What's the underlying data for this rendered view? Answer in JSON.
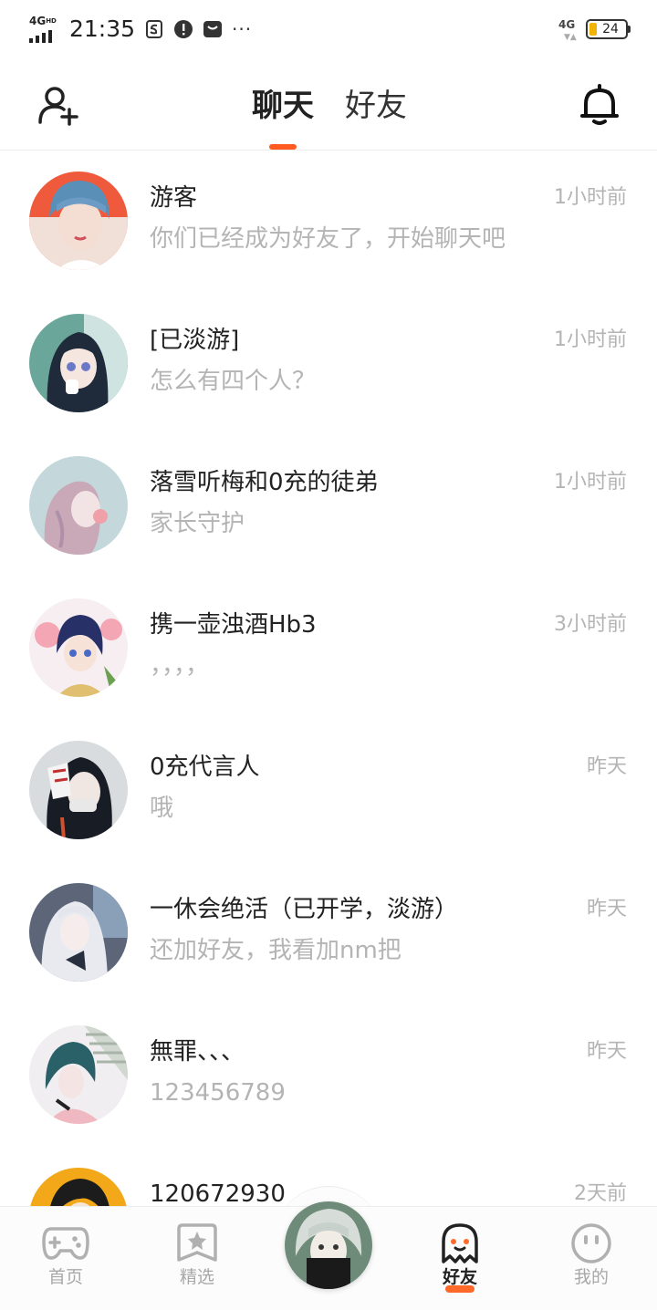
{
  "status_bar": {
    "network": "4G",
    "network_sup": "HD",
    "time": "21:35",
    "right_network": "4G",
    "battery": "24",
    "battery_level": 0.24,
    "more": "···"
  },
  "header": {
    "tabs": [
      {
        "label": "聊天",
        "active": true
      },
      {
        "label": "好友",
        "active": false
      }
    ],
    "accent_color": "#ff5a1f",
    "left_icon": "add-user-icon",
    "right_icon": "bell-icon"
  },
  "chats": [
    {
      "name": "游客",
      "message": "你们已经成为好友了，开始聊天吧",
      "time": "1小时前"
    },
    {
      "name": "[已淡游]",
      "message": "怎么有四个人？",
      "time": "1小时前"
    },
    {
      "name": "落雪听梅和0充的徒弟",
      "message": "家长守护",
      "time": "1小时前"
    },
    {
      "name": "携一壶浊酒Hb3",
      "message": "，，，，",
      "time": "3小时前"
    },
    {
      "name": "0充代言人",
      "message": "哦",
      "time": "昨天"
    },
    {
      "name": "一休会绝活（已开学，淡游）",
      "message": "还加好友，我看加nm把",
      "time": "昨天"
    },
    {
      "name": "無罪、、、",
      "message": "123456789",
      "time": "昨天"
    },
    {
      "name": "120672930",
      "message": "",
      "time": "2天前"
    }
  ],
  "bottom_nav": {
    "items": [
      {
        "label": "首页",
        "icon": "gamepad-icon"
      },
      {
        "label": "精选",
        "icon": "star-badge-icon"
      },
      {
        "label": "好友",
        "icon": "ghost-icon",
        "active": true
      },
      {
        "label": "我的",
        "icon": "smiley-icon"
      }
    ],
    "center_icon": "profile-avatar"
  }
}
